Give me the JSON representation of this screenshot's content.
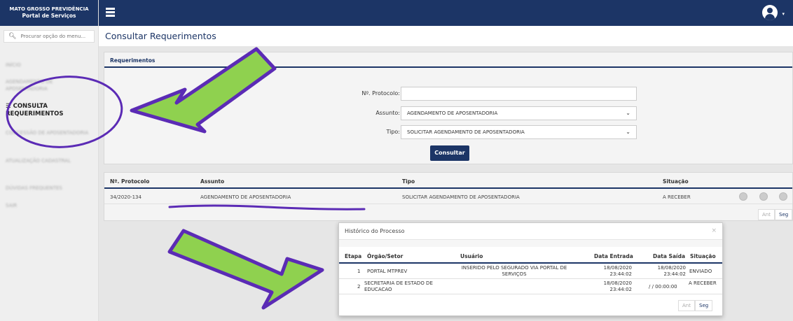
{
  "brand": {
    "line1": "MATO GROSSO PREVIDÊNCIA",
    "line2": "Portal de Serviços"
  },
  "search": {
    "placeholder": "Procurar opção do menu..."
  },
  "sidebar": {
    "items": [
      {
        "label": "INÍCIO"
      },
      {
        "label": "AGENDAMENTO DE APOSENTADORIA"
      },
      {
        "label": "CONSULTA REQUERIMENTOS"
      },
      {
        "label": "CONCESSÃO DE APOSENTADORIA"
      },
      {
        "label": "ATUALIZAÇÃO CADASTRAL"
      },
      {
        "label": "DÚVIDAS FREQUENTES"
      },
      {
        "label": "SAIR"
      }
    ]
  },
  "page": {
    "title": "Consultar Requerimentos"
  },
  "form": {
    "panel_title": "Requerimentos",
    "protocol_label": "Nº. Protocolo:",
    "protocol_value": "",
    "subject_label": "Assunto:",
    "subject_value": "AGENDAMENTO DE APOSENTADORIA",
    "type_label": "Tipo:",
    "type_value": "SOLICITAR AGENDAMENTO DE APOSENTADORIA",
    "submit_label": "Consultar"
  },
  "results": {
    "headers": [
      "Nº. Protocolo",
      "Assunto",
      "Tipo",
      "Situação"
    ],
    "rows": [
      {
        "protocolo": "34/2020-134",
        "assunto": "AGENDAMENTO DE APOSENTADORIA",
        "tipo": "SOLICITAR AGENDAMENTO DE APOSENTADORIA",
        "situacao": "A RECEBER"
      }
    ],
    "prev_label": "Ant",
    "next_label": "Seg"
  },
  "modal": {
    "title": "Histórico do Processo",
    "close": "×",
    "headers": [
      "Etapa",
      "Órgão/Setor",
      "Usuário",
      "Data Entrada",
      "Data Saída",
      "Situação"
    ],
    "rows": [
      {
        "etapa": "1",
        "orgao": "PORTAL MTPREV",
        "usuario": "INSERIDO PELO SEGURADO VIA PORTAL DE SERVIÇOS",
        "entrada": "18/08/2020 23:44:02",
        "saida": "18/08/2020 23:44:02",
        "situacao": "ENVIADO"
      },
      {
        "etapa": "2",
        "orgao": "SECRETARIA DE ESTADO DE EDUCACAO",
        "usuario": "",
        "entrada": "18/08/2020 23:44:02",
        "saida": "/ / 00:00:00",
        "situacao": "A RECEBER"
      }
    ],
    "prev_label": "Ant",
    "next_label": "Seg"
  },
  "colors": {
    "navy": "#1c3566",
    "annotation_purple": "#5b2bb5",
    "arrow_green": "#8fd14f"
  }
}
